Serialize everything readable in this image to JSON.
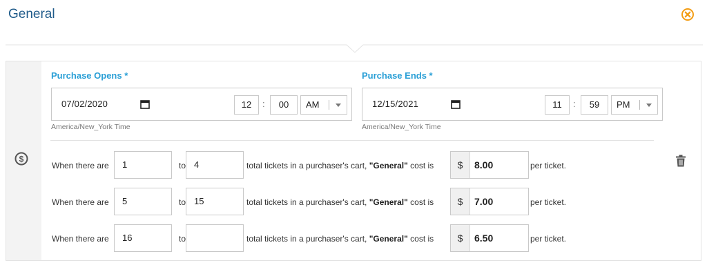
{
  "title": "General",
  "icons": {
    "close": "close-circle-icon",
    "dollar": "dollar-circle-icon",
    "trash": "trash-icon",
    "calendar": "calendar-icon",
    "dropdown": "chevron-down-icon"
  },
  "colors": {
    "title": "#1f5b8a",
    "label": "#2a9fd6",
    "close": "#f39c12"
  },
  "purchase_opens": {
    "label": "Purchase Opens *",
    "date": "07/02/2020",
    "hour": "12",
    "minute": "00",
    "ampm": "AM",
    "timezone": "America/New_York Time"
  },
  "purchase_ends": {
    "label": "Purchase Ends *",
    "date": "12/15/2021",
    "hour": "11",
    "minute": "59",
    "ampm": "PM",
    "timezone": "America/New_York Time"
  },
  "text": {
    "when": "When there are",
    "to": "to",
    "middle_prefix": "total tickets in a purchaser's cart,",
    "ticket_name": "\"General\"",
    "middle_suffix": "cost is",
    "currency": "$",
    "per_ticket": "per ticket.",
    "colon": ":"
  },
  "tiers": [
    {
      "from": "1",
      "to": "4",
      "price": "8.00"
    },
    {
      "from": "5",
      "to": "15",
      "price": "7.00"
    },
    {
      "from": "16",
      "to": "",
      "price": "6.50"
    }
  ]
}
